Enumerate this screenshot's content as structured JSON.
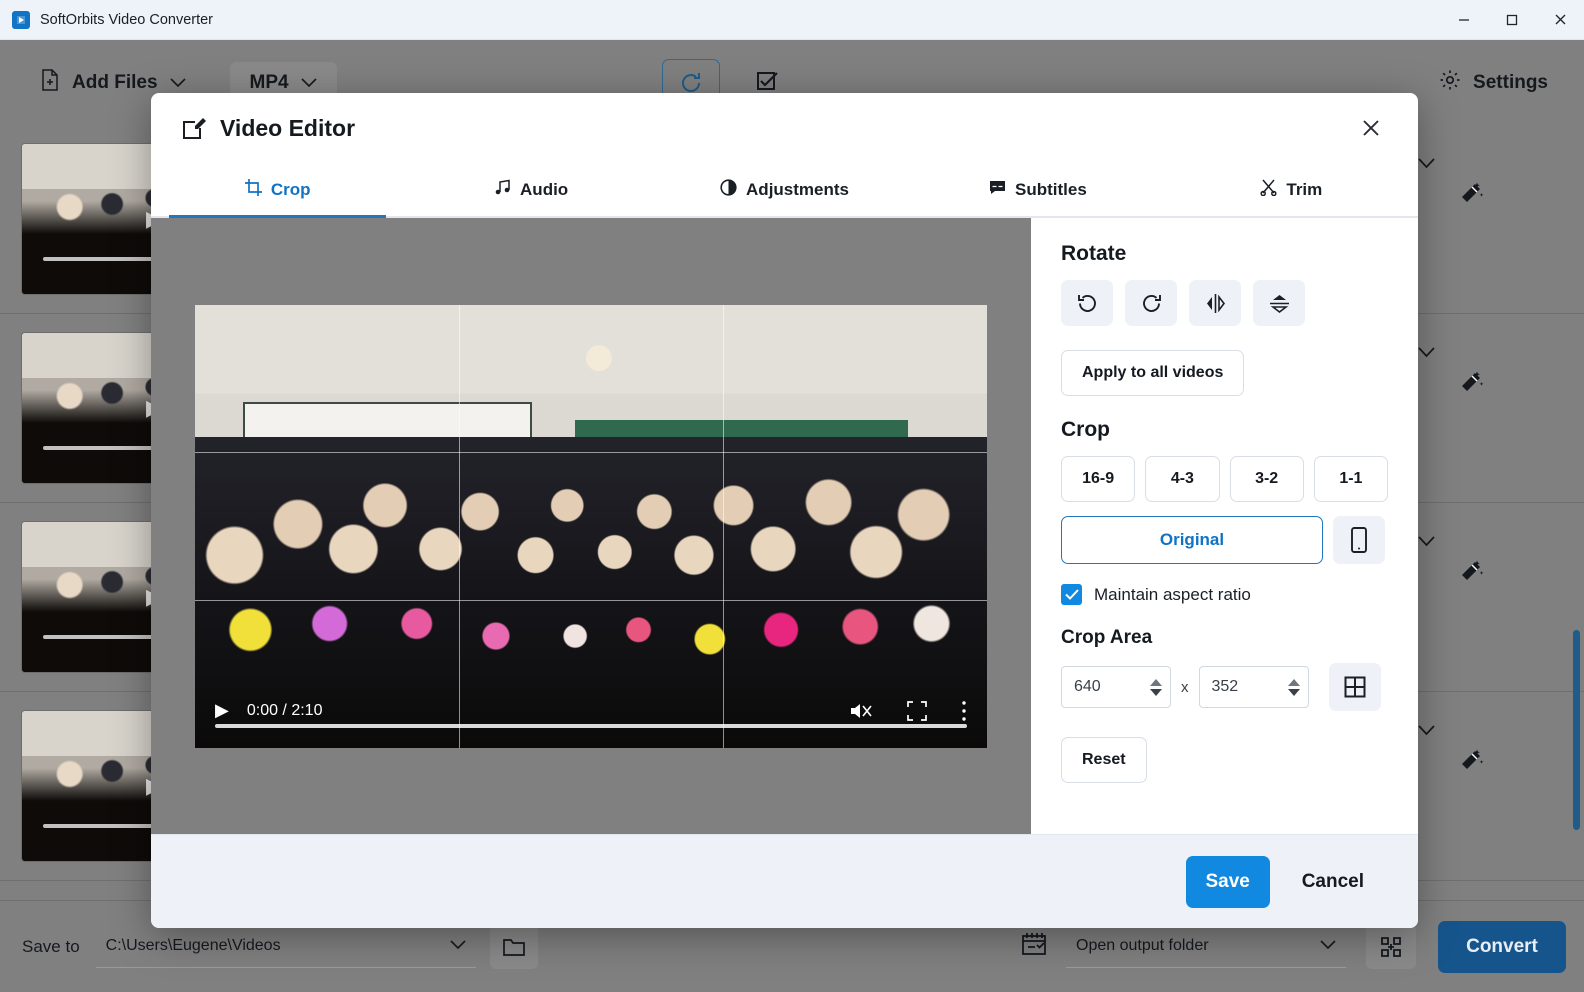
{
  "window": {
    "title": "SoftOrbits Video Converter",
    "app_icon": "app-logo-icon",
    "minimize": "—",
    "maximize": "□",
    "close": "✕"
  },
  "toolbar": {
    "add_files_label": "Add Files",
    "add_files_icon": "file-plus-icon",
    "add_files_chevron": "chevron-down-icon",
    "format_label": "MP4",
    "format_chevron": "chevron-down-icon",
    "refresh_icon": "refresh-icon",
    "select_all_icon": "checkbox-checked-icon",
    "settings_label": "Settings",
    "settings_icon": "gear-icon"
  },
  "file_rows": [
    {
      "chevron": "chevron-down-icon",
      "wand": "magic-wand-icon",
      "play": "▶"
    },
    {
      "chevron": "chevron-down-icon",
      "wand": "magic-wand-icon",
      "play": "▶"
    },
    {
      "chevron": "chevron-down-icon",
      "wand": "magic-wand-icon",
      "play": "▶"
    },
    {
      "chevron": "chevron-down-icon",
      "wand": "magic-wand-icon",
      "play": "▶"
    }
  ],
  "bottom_bar": {
    "save_to_label": "Save to",
    "save_to_path": "C:\\Users\\Eugene\\Videos",
    "path_chevron": "chevron-down-icon",
    "folder_icon": "folder-icon",
    "calendar_icon": "calendar-check-icon",
    "post_action": "Open output folder",
    "post_action_chevron": "chevron-down-icon",
    "grid_icon": "merge-icon",
    "convert_label": "Convert"
  },
  "modal": {
    "title": "Video Editor",
    "title_icon": "edit-pencil-icon",
    "close_icon": "close-icon",
    "tabs": [
      {
        "label": "Crop",
        "icon": "crop-icon",
        "active": true
      },
      {
        "label": "Audio",
        "icon": "music-note-icon",
        "active": false
      },
      {
        "label": "Adjustments",
        "icon": "contrast-icon",
        "active": false
      },
      {
        "label": "Subtitles",
        "icon": "subtitles-icon",
        "active": false
      },
      {
        "label": "Trim",
        "icon": "scissors-icon",
        "active": false
      }
    ],
    "player": {
      "play_icon": "play-icon",
      "time": "0:00 / 2:10",
      "mute_icon": "volume-muted-icon",
      "fullscreen_icon": "fullscreen-icon",
      "more_icon": "more-vertical-icon"
    },
    "panel": {
      "rotate_heading": "Rotate",
      "rotate_buttons": [
        {
          "name": "rotate-left-icon"
        },
        {
          "name": "rotate-right-icon"
        },
        {
          "name": "flip-horizontal-icon"
        },
        {
          "name": "flip-vertical-icon"
        }
      ],
      "apply_all_label": "Apply to all videos",
      "crop_heading": "Crop",
      "ratios": [
        "16-9",
        "4-3",
        "3-2",
        "1-1"
      ],
      "original_label": "Original",
      "phone_icon": "phone-portrait-icon",
      "maintain_aspect_label": "Maintain aspect ratio",
      "maintain_aspect_checked": true,
      "crop_area_heading": "Crop Area",
      "crop_width": "640",
      "crop_height": "352",
      "crop_dim_separator": "x",
      "grid_icon": "grid-icon",
      "reset_label": "Reset"
    },
    "footer": {
      "save_label": "Save",
      "cancel_label": "Cancel"
    }
  },
  "colors": {
    "accent_blue": "#1173c4",
    "save_blue": "#1189e0",
    "convert_blue": "#16558c",
    "app_gray": "#808080",
    "footer_bg": "#eef2f8"
  }
}
